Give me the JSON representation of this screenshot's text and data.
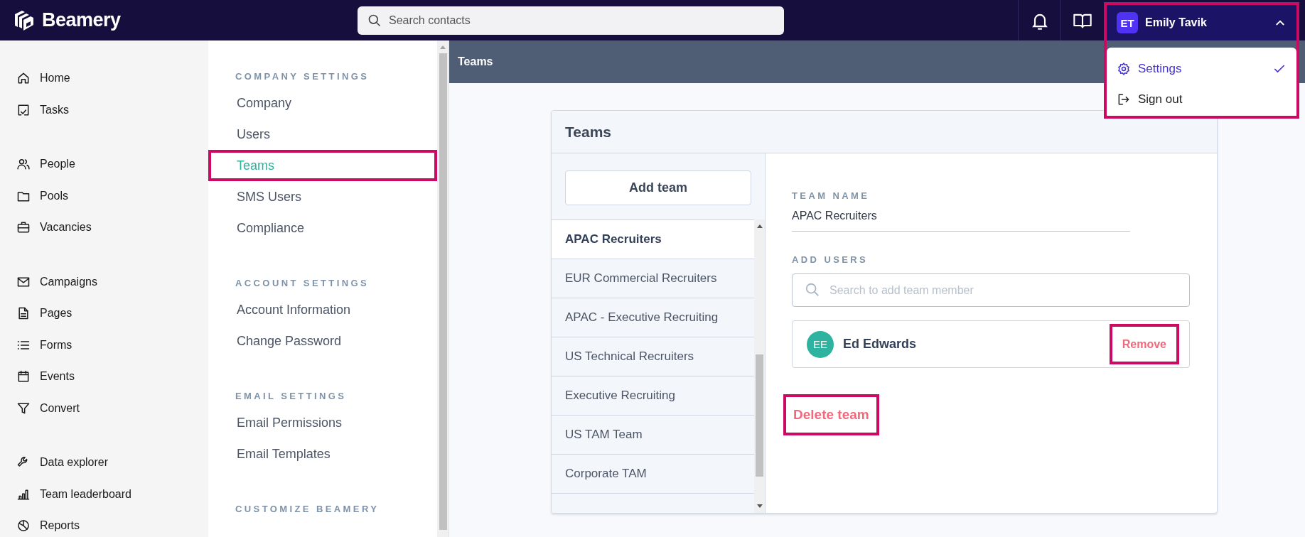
{
  "top_bar": {
    "logo": "Beamery",
    "search": {
      "placeholder": "Search contacts"
    }
  },
  "user_menu": {
    "initials": "ET",
    "name": "Emily Tavik",
    "expanded": true,
    "highlighted": true,
    "items": [
      {
        "label": "Settings",
        "selected": true
      },
      {
        "label": "Sign out",
        "selected": false
      }
    ]
  },
  "nav": {
    "groups": [
      {
        "items": [
          {
            "label": "Home"
          },
          {
            "label": "Tasks"
          }
        ]
      },
      {
        "items": [
          {
            "label": "People"
          },
          {
            "label": "Pools"
          },
          {
            "label": "Vacancies"
          }
        ]
      },
      {
        "items": [
          {
            "label": "Campaigns"
          },
          {
            "label": "Pages"
          },
          {
            "label": "Forms"
          },
          {
            "label": "Events"
          },
          {
            "label": "Convert"
          }
        ]
      },
      {
        "items": [
          {
            "label": "Data explorer"
          },
          {
            "label": "Team leaderboard"
          },
          {
            "label": "Reports"
          }
        ]
      }
    ]
  },
  "settings_menu": {
    "sections": [
      {
        "title": "COMPANY SETTINGS",
        "items": [
          {
            "label": "Company",
            "selected": false,
            "highlighted": false
          },
          {
            "label": "Users",
            "selected": false,
            "highlighted": false
          },
          {
            "label": "Teams",
            "selected": true,
            "highlighted": true
          },
          {
            "label": "SMS Users",
            "selected": false,
            "highlighted": false
          },
          {
            "label": "Compliance",
            "selected": false,
            "highlighted": false
          }
        ]
      },
      {
        "title": "ACCOUNT SETTINGS",
        "items": [
          {
            "label": "Account Information",
            "selected": false,
            "highlighted": false
          },
          {
            "label": "Change Password",
            "selected": false,
            "highlighted": false
          }
        ]
      },
      {
        "title": "EMAIL SETTINGS",
        "items": [
          {
            "label": "Email Permissions",
            "selected": false,
            "highlighted": false
          },
          {
            "label": "Email Templates",
            "selected": false,
            "highlighted": false
          }
        ]
      },
      {
        "title": "CUSTOMIZE BEAMERY"
      }
    ]
  },
  "page_header": {
    "title": "Teams"
  },
  "teams_card": {
    "title": "Teams",
    "add_button": "Add team",
    "teams": [
      {
        "name": "APAC Recruiters",
        "selected": true
      },
      {
        "name": "EUR Commercial Recruiters",
        "selected": false
      },
      {
        "name": "APAC - Executive Recruiting",
        "selected": false
      },
      {
        "name": "US Technical Recruiters",
        "selected": false
      },
      {
        "name": "Executive Recruiting",
        "selected": false
      },
      {
        "name": "US TAM Team",
        "selected": false
      },
      {
        "name": "Corporate TAM",
        "selected": false
      }
    ],
    "detail": {
      "team_name_label": "TEAM NAME",
      "team_name": "APAC Recruiters",
      "add_users_label": "ADD USERS",
      "search": {
        "placeholder": "Search to add team member"
      },
      "members": [
        {
          "initials": "EE",
          "name": "Ed Edwards",
          "remove": {
            "label": "Remove",
            "highlighted": true
          }
        }
      ],
      "delete": {
        "label": "Delete team",
        "highlighted": true
      }
    }
  }
}
